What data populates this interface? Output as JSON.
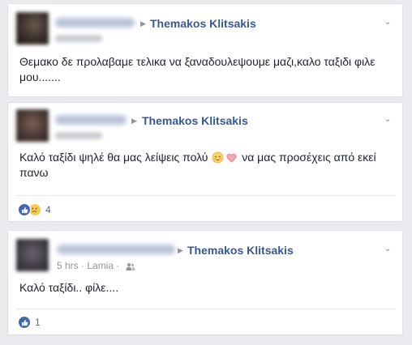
{
  "posts": [
    {
      "target": "Themakos Klitsakis",
      "timestamp": "4 hrs",
      "text": "Θεμακο δε προλαβαμε τελικα να ξαναδουλεψουμε μαζι,καλο ταξιδι φιλε μου.......",
      "avatar_color": "#4a3a33"
    },
    {
      "target": "Themakos Klitsakis",
      "timestamp": "4 hrs",
      "text_before": "Καλό ταξίδι ψηλέ θα μας λείψεις πολύ",
      "text_after": "να μας προσέχεις από εκεί",
      "text_line2": "πανω",
      "reactions": [
        "like-icon",
        "sad-icon"
      ],
      "reaction_count": "4",
      "avatar_color": "#5a4a44"
    },
    {
      "target": "Themakos Klitsakis",
      "timestamp": "5 hrs · Lamia ·",
      "text": "Καλό ταξίδι.. φίλε....",
      "reactions": [
        "like-icon"
      ],
      "reaction_count": "1",
      "avatar_color": "#3e3e4a"
    }
  ],
  "colors": {
    "link": "#365899",
    "meta": "#90949c",
    "like": "#4267b2",
    "background": "#e9ebee"
  }
}
